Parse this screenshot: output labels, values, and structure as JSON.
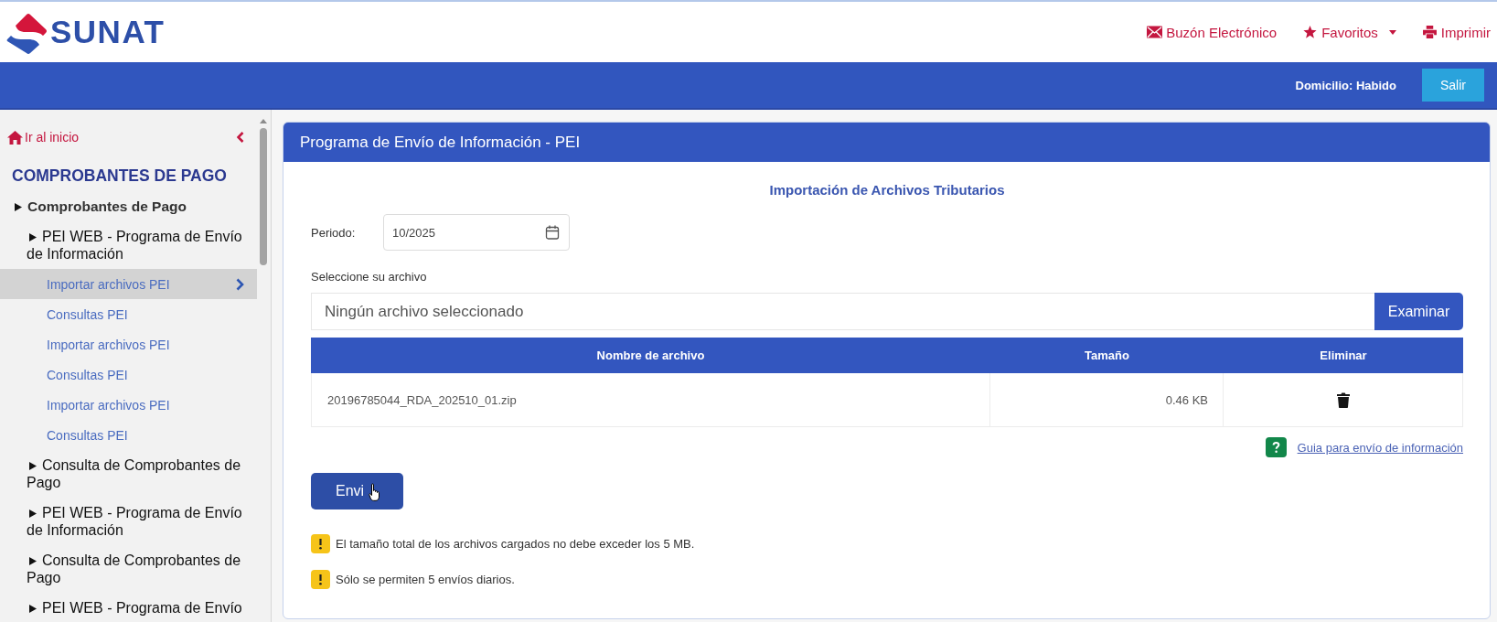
{
  "header": {
    "logo": "SUNAT",
    "links": [
      {
        "label": "Buzón Electrónico",
        "kind": "mail"
      },
      {
        "label": "Favoritos",
        "kind": "favorites"
      },
      {
        "label": "Imprimir",
        "kind": "print"
      }
    ]
  },
  "top_bar": {
    "status": "Domicilio: Habido",
    "logout_button": "Salir"
  },
  "sidebar": {
    "home_link": "Ir al inicio",
    "title": "COMPROBANTES DE PAGO",
    "items": [
      {
        "label": "Comprobantes de Pago",
        "kind": "group",
        "selected": false,
        "children": [
          {
            "label": "PEI WEB - Programa de Envío de Información",
            "kind": "group",
            "selected": false,
            "children": [
              {
                "label": "Importar archivos PEI",
                "kind": "link",
                "selected": true
              },
              {
                "label": "Consultas PEI",
                "kind": "link",
                "selected": false
              },
              {
                "label": "Importar archivos PEI",
                "kind": "link",
                "selected": false
              },
              {
                "label": "Consultas PEI",
                "kind": "link",
                "selected": false
              },
              {
                "label": "Importar archivos PEI",
                "kind": "link",
                "selected": false
              },
              {
                "label": "Consultas PEI",
                "kind": "link",
                "selected": false
              }
            ]
          },
          {
            "label": "Consulta de Comprobantes de Pago",
            "kind": "group",
            "selected": false
          },
          {
            "label": "PEI WEB - Programa de Envío de Información",
            "kind": "group",
            "selected": false
          },
          {
            "label": "Consulta de Comprobantes de Pago",
            "kind": "group",
            "selected": false
          },
          {
            "label": "PEI WEB - Programa de Envío",
            "kind": "group",
            "selected": false
          }
        ]
      }
    ]
  },
  "panel": {
    "title": "Programa de Envío de Información - PEI",
    "heading": "Importación de Archivos Tributarios",
    "period": {
      "label": "Periodo:",
      "value": "10/2025"
    },
    "file": {
      "label": "Seleccione su archivo",
      "value": "Ningún archivo seleccionado",
      "button": "Examinar"
    },
    "table": {
      "columns": [
        "Nombre de archivo",
        "Tamaño",
        "Eliminar"
      ],
      "rows": [
        {
          "file_name": "20196785044_RDA_202510_01.zip",
          "size": "0.46 KB"
        }
      ]
    },
    "help_link": "Guia para envío de información",
    "submit_button": "Envi",
    "notes": [
      "El tamaño total de los archivos cargados no debe exceder los 5 MB.",
      "Sólo se permiten 5 envíos diarios."
    ]
  }
}
